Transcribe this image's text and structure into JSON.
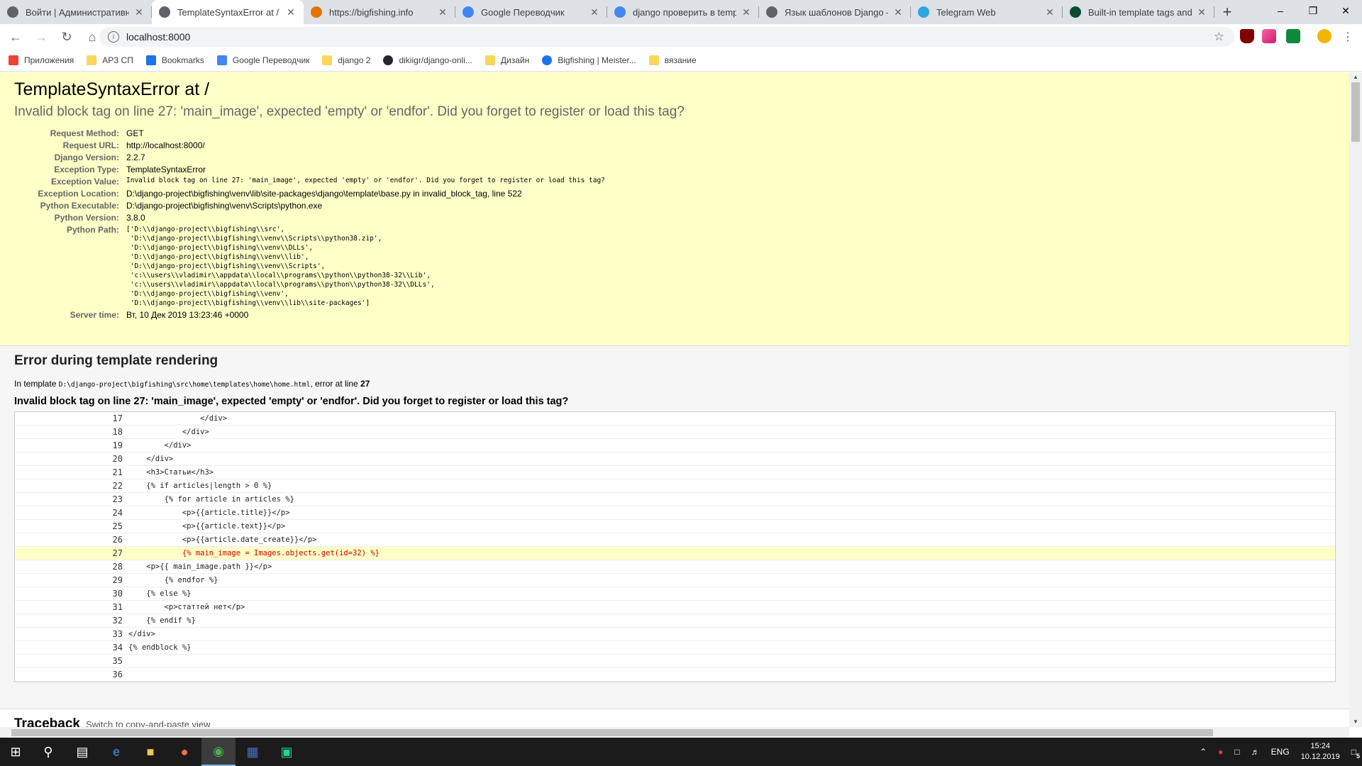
{
  "browser": {
    "tabs": [
      {
        "title": "Войти | Административный",
        "icon": "globe-icon",
        "color": "#5f6368",
        "active": false
      },
      {
        "title": "TemplateSyntaxError at /",
        "icon": "globe-icon",
        "color": "#5f6368",
        "active": true
      },
      {
        "title": "https://bigfishing.info",
        "icon": "bigfishing-icon",
        "color": "#e37400",
        "active": false
      },
      {
        "title": "Google Переводчик",
        "icon": "google-translate-icon",
        "color": "#4285f4",
        "active": false
      },
      {
        "title": "django проверить в templ",
        "icon": "google-icon",
        "color": "#4285f4",
        "active": false
      },
      {
        "title": "Язык шаблонов Django —",
        "icon": "globe-icon",
        "color": "#5f6368",
        "active": false
      },
      {
        "title": "Telegram Web",
        "icon": "telegram-icon",
        "color": "#2ca5e0",
        "active": false
      },
      {
        "title": "Built-in template tags and",
        "icon": "django-icon",
        "color": "#0c4b33",
        "active": false
      }
    ],
    "url": "localhost:8000",
    "bookmarks": [
      {
        "label": "Приложения",
        "icon": "apps-icon"
      },
      {
        "label": "АРЗ СП",
        "icon": "folder-icon"
      },
      {
        "label": "Bookmarks",
        "icon": "star-icon"
      },
      {
        "label": "Google Переводчик",
        "icon": "google-translate-icon"
      },
      {
        "label": "django 2",
        "icon": "folder-icon"
      },
      {
        "label": "dikiigr/django-onli...",
        "icon": "github-icon"
      },
      {
        "label": "Дизайн",
        "icon": "folder-icon"
      },
      {
        "label": "Bigfishing | Meister...",
        "icon": "check-icon"
      },
      {
        "label": "вязание",
        "icon": "folder-icon"
      }
    ]
  },
  "error": {
    "title": "TemplateSyntaxError at /",
    "message": "Invalid block tag on line 27: 'main_image', expected 'empty' or 'endfor'. Did you forget to register or load this tag?",
    "meta": [
      {
        "key": "Request Method:",
        "value": "GET",
        "mono": false
      },
      {
        "key": "Request URL:",
        "value": "http://localhost:8000/",
        "mono": false
      },
      {
        "key": "Django Version:",
        "value": "2.2.7",
        "mono": false
      },
      {
        "key": "Exception Type:",
        "value": "TemplateSyntaxError",
        "mono": false
      },
      {
        "key": "Exception Value:",
        "value": "Invalid block tag on line 27: 'main_image', expected 'empty' or 'endfor'. Did you forget to register or load this tag?",
        "mono": true
      },
      {
        "key": "Exception Location:",
        "value": "D:\\django-project\\bigfishing\\venv\\lib\\site-packages\\django\\template\\base.py in invalid_block_tag, line 522",
        "mono": false
      },
      {
        "key": "Python Executable:",
        "value": "D:\\django-project\\bigfishing\\venv\\Scripts\\python.exe",
        "mono": false
      },
      {
        "key": "Python Version:",
        "value": "3.8.0",
        "mono": false
      }
    ],
    "python_path_label": "Python Path:",
    "python_path": "['D:\\\\django-project\\\\bigfishing\\\\src',\n 'D:\\\\django-project\\\\bigfishing\\\\venv\\\\Scripts\\\\python38.zip',\n 'D:\\\\django-project\\\\bigfishing\\\\venv\\\\DLLs',\n 'D:\\\\django-project\\\\bigfishing\\\\venv\\\\lib',\n 'D:\\\\django-project\\\\bigfishing\\\\venv\\\\Scripts',\n 'c:\\\\users\\\\vladimir\\\\appdata\\\\local\\\\programs\\\\python\\\\python38-32\\\\Lib',\n 'c:\\\\users\\\\vladimir\\\\appdata\\\\local\\\\programs\\\\python\\\\python38-32\\\\DLLs',\n 'D:\\\\django-project\\\\bigfishing\\\\venv',\n 'D:\\\\django-project\\\\bigfishing\\\\venv\\\\lib\\\\site-packages']",
    "server_time_label": "Server time:",
    "server_time": "Вт, 10 Дек 2019 13:23:46 +0000"
  },
  "template_error": {
    "heading": "Error during template rendering",
    "in_template_prefix": "In template",
    "template_path": "D:\\django-project\\bigfishing\\src\\home\\templates\\home\\home.html",
    "error_at": ", error at line",
    "line": "27",
    "message": "Invalid block tag on line 27: 'main_image', expected 'empty' or 'endfor'. Did you forget to register or load this tag?",
    "source_lines": [
      {
        "n": "17",
        "code": "                </div>",
        "err": false
      },
      {
        "n": "18",
        "code": "            </div>",
        "err": false
      },
      {
        "n": "19",
        "code": "        </div>",
        "err": false
      },
      {
        "n": "20",
        "code": "    </div>",
        "err": false
      },
      {
        "n": "21",
        "code": "    <h3>Статьи</h3>",
        "err": false
      },
      {
        "n": "22",
        "code": "    {% if articles|length > 0 %}",
        "err": false
      },
      {
        "n": "23",
        "code": "        {% for article in articles %}",
        "err": false
      },
      {
        "n": "24",
        "code": "            <p>{{article.title}}</p>",
        "err": false
      },
      {
        "n": "25",
        "code": "            <p>{{article.text}}</p>",
        "err": false
      },
      {
        "n": "26",
        "code": "            <p>{{article.date_create}}</p>",
        "err": false
      },
      {
        "n": "27",
        "code": "            {% main_image = Images.objects.get(id=32) %}",
        "err": true
      },
      {
        "n": "28",
        "code": "    <p>{{ main_image.path }}</p>",
        "err": false
      },
      {
        "n": "29",
        "code": "        {% endfor %}",
        "err": false
      },
      {
        "n": "30",
        "code": "    {% else %}",
        "err": false
      },
      {
        "n": "31",
        "code": "        <p>статтей нет</p>",
        "err": false
      },
      {
        "n": "32",
        "code": "    {% endif %}",
        "err": false
      },
      {
        "n": "33",
        "code": "</div>",
        "err": false
      },
      {
        "n": "34",
        "code": "{% endblock %}",
        "err": false
      },
      {
        "n": "35",
        "code": "",
        "err": false
      },
      {
        "n": "36",
        "code": "",
        "err": false
      }
    ]
  },
  "traceback": {
    "heading": "Traceback",
    "link": "Switch to copy-and-paste view"
  },
  "taskbar": {
    "lang": "ENG",
    "time": "15:24",
    "date": "10.12.2019",
    "notifications": "5"
  }
}
